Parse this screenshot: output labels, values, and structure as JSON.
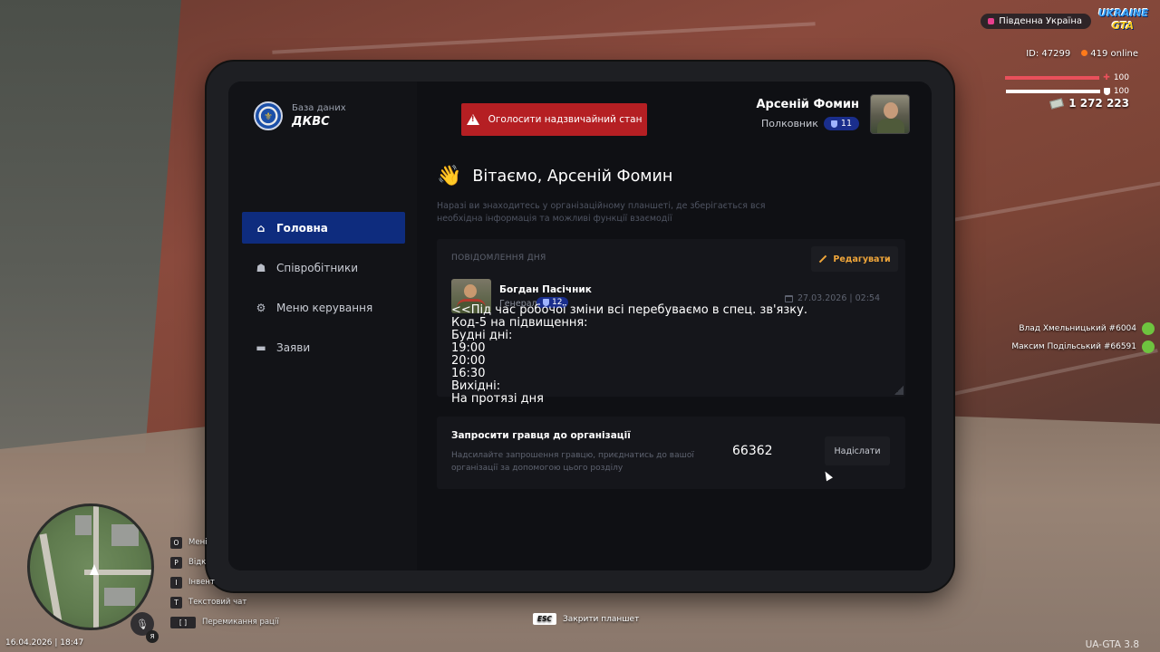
{
  "hud": {
    "region": "Південна Україна",
    "logo_line1": "UKRAINE",
    "logo_line2": "GTA",
    "player_id": "ID: 47299",
    "online": "419 online",
    "health": "100",
    "armor": "100",
    "health_level": 1.0,
    "armor_level": 1.0,
    "money": "1 272 223",
    "nearby_players": [
      "Влад Хмельницький #6004",
      "Максим Подільський #66591"
    ],
    "datetime": "16.04.2026 | 18:47",
    "mic_key": "Я",
    "keyhints": [
      {
        "key": "O",
        "label": "Мені"
      },
      {
        "key": "P",
        "label": "Відк"
      },
      {
        "key": "I",
        "label": "Інвент"
      },
      {
        "key": "T",
        "label": "Текстовий чат"
      },
      {
        "key": "[ ]",
        "label": "Перемикання рації"
      }
    ],
    "esc_key": "ESC",
    "esc_label": "Закрити планшет",
    "version": "UA-GTA 3.8"
  },
  "colors": {
    "accent": "#0e2c7e",
    "alert": "#b51f23",
    "edit": "#f0a63a",
    "health": "#e8505b",
    "armor": "#ffffff"
  },
  "tablet": {
    "logo_subtitle": "База даних",
    "logo_title": "ДКВС",
    "nav": [
      {
        "label": "Головна",
        "icon": "home-icon",
        "active": true
      },
      {
        "label": "Співробітники",
        "icon": "people-icon",
        "active": false
      },
      {
        "label": "Меню керування",
        "icon": "gear-icon",
        "active": false
      },
      {
        "label": "Заяви",
        "icon": "folder-icon",
        "active": false
      }
    ],
    "alert_button": "Оголосити надзвичайний стан",
    "profile": {
      "name": "Арсеній Фомин",
      "rank": "Полковник",
      "level": "11"
    },
    "greeting": "Вітаємо, Арсеній Фомин",
    "greeting_desc": "Наразі ви знаходитесь у організаційному планшеті, де зберігається вся необхідна інформація та можливі функції взаємодії",
    "motd": {
      "label": "ПОВІДОМЛЕННЯ ДНЯ",
      "edit": "Редагувати",
      "author": "Богдан Пасічник",
      "author_rank": "Генерал",
      "author_level": "12",
      "date": "27.03.2026 | 02:54",
      "text": "<<Під час робочої зміни всі перебуваємо в спец. зв'язку.\nКод-5 на підвищення:\nБудні дні:\n19:00\n20:00\n16:30\nВихідні:\nНа протязі дня"
    },
    "invite": {
      "title": "Запросити гравця до організації",
      "desc": "Надсилайте запрошення гравцю, приєднатись до вашої організації за допомогою цього розділу",
      "value": "66362",
      "send": "Надіслати"
    }
  }
}
